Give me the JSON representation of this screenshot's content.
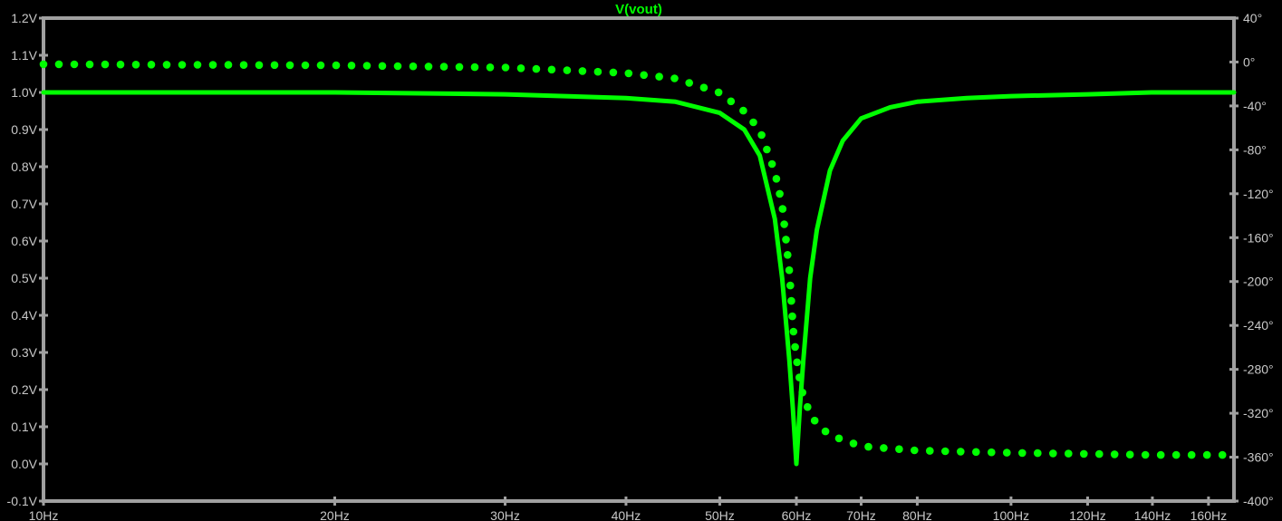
{
  "chart_data": {
    "type": "line",
    "title": "V(vout)",
    "x_scale": "log",
    "x_range_hz": [
      10,
      170
    ],
    "x_tick_values": [
      10,
      20,
      30,
      40,
      50,
      60,
      70,
      80,
      100,
      120,
      140,
      160
    ],
    "x_tick_labels": [
      "10Hz",
      "20Hz",
      "30Hz",
      "40Hz",
      "50Hz",
      "60Hz",
      "70Hz",
      "80Hz",
      "100Hz",
      "120Hz",
      "140Hz",
      "160Hz"
    ],
    "y_left_range": [
      -0.1,
      1.2
    ],
    "y_left_ticks": [
      -0.1,
      0.0,
      0.1,
      0.2,
      0.3,
      0.4,
      0.5,
      0.6,
      0.7,
      0.8,
      0.9,
      1.0,
      1.1,
      1.2
    ],
    "y_left_tick_labels": [
      "-0.1V",
      "0.0V",
      "0.1V",
      "0.2V",
      "0.3V",
      "0.4V",
      "0.5V",
      "0.6V",
      "0.7V",
      "0.8V",
      "0.9V",
      "1.0V",
      "1.1V",
      "1.2V"
    ],
    "y_right_range": [
      -400,
      40
    ],
    "y_right_ticks": [
      40,
      0,
      -40,
      -80,
      -120,
      -160,
      -200,
      -240,
      -280,
      -320,
      -360,
      -400
    ],
    "y_right_tick_labels": [
      "40°",
      "0°",
      "-40°",
      "-80°",
      "-120°",
      "-160°",
      "-200°",
      "-240°",
      "-280°",
      "-320°",
      "-360°",
      "-400°"
    ],
    "grid": false,
    "colors": {
      "background": "#000000",
      "trace": "#00ff00",
      "axis": "#a0a0a0",
      "tick_text": "#c8c8c8"
    },
    "series": [
      {
        "axis": "left",
        "style": "solid",
        "x": [
          10,
          20,
          30,
          40,
          45,
          50,
          53,
          55,
          57,
          58,
          59,
          59.5,
          60,
          60.5,
          61,
          62,
          63,
          65,
          67,
          70,
          75,
          80,
          90,
          100,
          120,
          140,
          170
        ],
        "y": [
          1.0,
          1.0,
          0.995,
          0.985,
          0.975,
          0.945,
          0.9,
          0.83,
          0.66,
          0.5,
          0.28,
          0.15,
          0.0,
          0.15,
          0.28,
          0.5,
          0.63,
          0.79,
          0.87,
          0.93,
          0.96,
          0.975,
          0.985,
          0.99,
          0.995,
          1.0,
          1.0
        ]
      },
      {
        "axis": "right",
        "style": "dotted",
        "x": [
          10,
          20,
          30,
          40,
          45,
          50,
          53,
          55,
          57,
          58,
          59,
          59.5,
          60,
          60.5,
          61,
          62,
          63,
          65,
          70,
          80,
          100,
          120,
          140,
          170
        ],
        "y": [
          -2,
          -3,
          -5,
          -10,
          -15,
          -28,
          -45,
          -62,
          -100,
          -130,
          -190,
          -240,
          -270,
          -290,
          -305,
          -320,
          -330,
          -340,
          -350,
          -354,
          -356,
          -357,
          -358,
          -358
        ]
      }
    ]
  }
}
